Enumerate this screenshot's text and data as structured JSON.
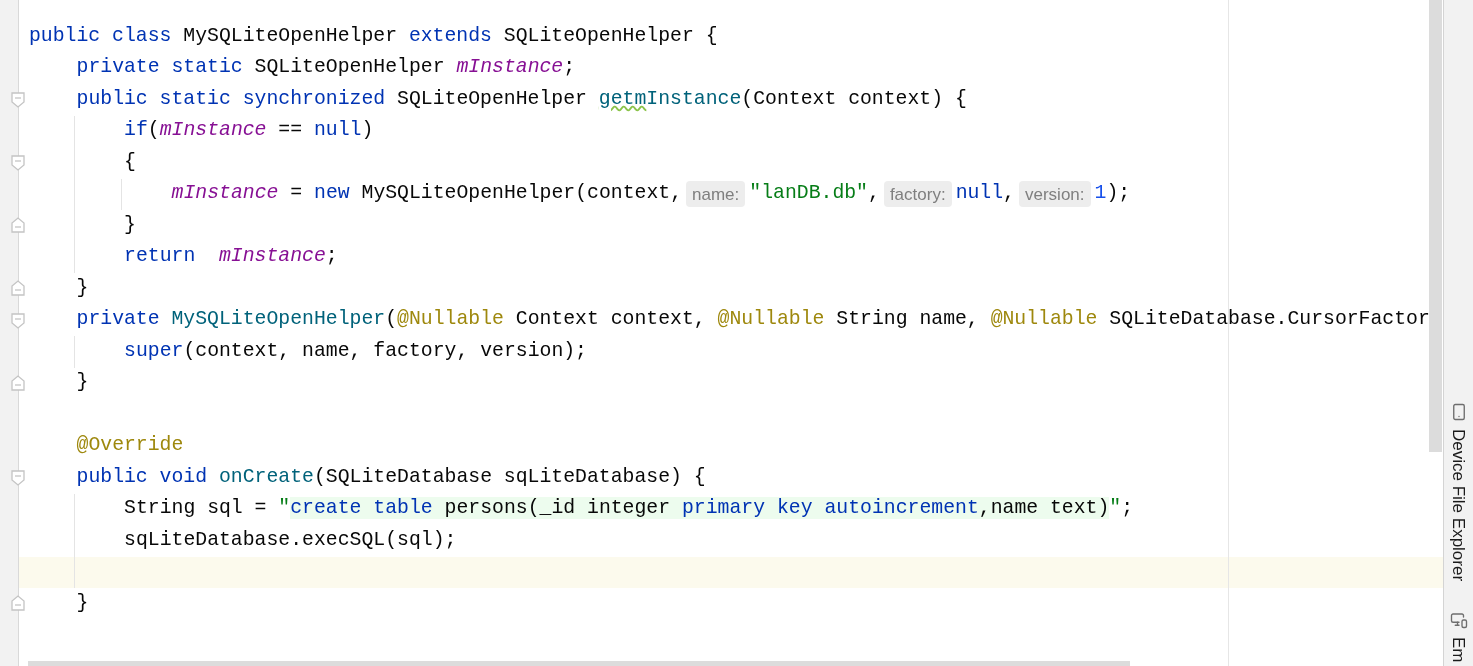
{
  "editor": {
    "lines": [
      {
        "current": false,
        "fold_start": false,
        "fold_end": false,
        "segments": [
          {
            "kind": "code",
            "tokens": [
              {
                "kind": "keyword",
                "text": "public class"
              },
              {
                "kind": "plain",
                "text": " MySQLiteOpenHelper "
              },
              {
                "kind": "keyword",
                "text": "extends"
              },
              {
                "kind": "plain",
                "text": " SQLiteOpenHelper {"
              }
            ]
          }
        ],
        "children": [
          {
            "current": false,
            "fold_start": false,
            "fold_end": false,
            "segments": [
              {
                "kind": "code",
                "tokens": [
                  {
                    "kind": "keyword",
                    "text": "private static"
                  },
                  {
                    "kind": "plain",
                    "text": " SQLiteOpenHelper "
                  },
                  {
                    "kind": "field",
                    "text": "mInstance"
                  },
                  {
                    "kind": "plain",
                    "text": ";"
                  }
                ]
              }
            ]
          },
          {
            "current": false,
            "fold_start": true,
            "fold_end": false,
            "segments": [
              {
                "kind": "code",
                "tokens": [
                  {
                    "kind": "keyword",
                    "text": "public static synchronized"
                  },
                  {
                    "kind": "plain",
                    "text": " SQLiteOpenHelper "
                  },
                  {
                    "kind": "method_warning",
                    "text": "getm"
                  },
                  {
                    "kind": "method",
                    "text": "Instance"
                  },
                  {
                    "kind": "plain",
                    "text": "(Context context) {"
                  }
                ]
              }
            ],
            "children": [
              {
                "current": false,
                "fold_start": false,
                "fold_end": false,
                "segments": [
                  {
                    "kind": "code",
                    "tokens": [
                      {
                        "kind": "keyword",
                        "text": "if"
                      },
                      {
                        "kind": "plain",
                        "text": "("
                      },
                      {
                        "kind": "field",
                        "text": "mInstance"
                      },
                      {
                        "kind": "plain",
                        "text": " == "
                      },
                      {
                        "kind": "keyword",
                        "text": "null"
                      },
                      {
                        "kind": "plain",
                        "text": ")"
                      }
                    ]
                  }
                ]
              },
              {
                "current": false,
                "fold_start": true,
                "fold_end": false,
                "segments": [
                  {
                    "kind": "code",
                    "tokens": [
                      {
                        "kind": "plain",
                        "text": "{"
                      }
                    ]
                  }
                ],
                "children": [
                  {
                    "current": false,
                    "fold_start": false,
                    "fold_end": false,
                    "segments": [
                      {
                        "kind": "code",
                        "tokens": [
                          {
                            "kind": "field",
                            "text": "mInstance"
                          },
                          {
                            "kind": "plain",
                            "text": " = "
                          },
                          {
                            "kind": "keyword",
                            "text": "new"
                          },
                          {
                            "kind": "plain",
                            "text": " MySQLiteOpenHelper(context,"
                          }
                        ]
                      },
                      {
                        "kind": "hint",
                        "text": "name:"
                      },
                      {
                        "kind": "code",
                        "tokens": [
                          {
                            "kind": "string",
                            "text": "\"lanDB.db\""
                          },
                          {
                            "kind": "plain",
                            "text": ","
                          }
                        ]
                      },
                      {
                        "kind": "hint",
                        "text": "factory:"
                      },
                      {
                        "kind": "code",
                        "tokens": [
                          {
                            "kind": "keyword",
                            "text": "null"
                          },
                          {
                            "kind": "plain",
                            "text": ","
                          }
                        ]
                      },
                      {
                        "kind": "hint",
                        "text": "version:"
                      },
                      {
                        "kind": "code",
                        "tokens": [
                          {
                            "kind": "number",
                            "text": "1"
                          },
                          {
                            "kind": "plain",
                            "text": ");"
                          }
                        ]
                      }
                    ]
                  }
                ]
              },
              {
                "current": false,
                "fold_start": false,
                "fold_end": true,
                "segments": [
                  {
                    "kind": "code",
                    "tokens": [
                      {
                        "kind": "plain",
                        "text": "}"
                      }
                    ]
                  }
                ]
              },
              {
                "current": false,
                "fold_start": false,
                "fold_end": false,
                "segments": [
                  {
                    "kind": "code",
                    "tokens": [
                      {
                        "kind": "keyword",
                        "text": "return  "
                      },
                      {
                        "kind": "field",
                        "text": "mInstance"
                      },
                      {
                        "kind": "plain",
                        "text": ";"
                      }
                    ]
                  }
                ]
              }
            ]
          },
          {
            "current": false,
            "fold_start": false,
            "fold_end": true,
            "segments": [
              {
                "kind": "code",
                "tokens": [
                  {
                    "kind": "plain",
                    "text": "}"
                  }
                ]
              }
            ]
          },
          {
            "current": false,
            "fold_start": true,
            "fold_end": false,
            "segments": [
              {
                "kind": "code",
                "tokens": [
                  {
                    "kind": "keyword",
                    "text": "private "
                  },
                  {
                    "kind": "method",
                    "text": "MySQLiteOpenHelper"
                  },
                  {
                    "kind": "plain",
                    "text": "("
                  },
                  {
                    "kind": "annotation",
                    "text": "@Nullable"
                  },
                  {
                    "kind": "plain",
                    "text": " Context context, "
                  },
                  {
                    "kind": "annotation",
                    "text": "@Nullable"
                  },
                  {
                    "kind": "plain",
                    "text": " String name, "
                  },
                  {
                    "kind": "annotation",
                    "text": "@Nullable"
                  },
                  {
                    "kind": "plain",
                    "text": " SQLiteDatabase.CursorFactor"
                  }
                ]
              }
            ],
            "children": [
              {
                "current": false,
                "fold_start": false,
                "fold_end": false,
                "segments": [
                  {
                    "kind": "code",
                    "tokens": [
                      {
                        "kind": "keyword",
                        "text": "super"
                      },
                      {
                        "kind": "plain",
                        "text": "(context, name, factory, version);"
                      }
                    ]
                  }
                ]
              }
            ]
          },
          {
            "current": false,
            "fold_start": false,
            "fold_end": true,
            "segments": [
              {
                "kind": "code",
                "tokens": [
                  {
                    "kind": "plain",
                    "text": "}"
                  }
                ]
              }
            ]
          },
          {
            "current": false,
            "fold_start": false,
            "fold_end": false
          },
          {
            "current": false,
            "fold_start": false,
            "fold_end": false,
            "segments": [
              {
                "kind": "code",
                "tokens": [
                  {
                    "kind": "annotation",
                    "text": "@Override"
                  }
                ]
              }
            ]
          },
          {
            "current": false,
            "fold_start": true,
            "fold_end": false,
            "segments": [
              {
                "kind": "code",
                "tokens": [
                  {
                    "kind": "keyword",
                    "text": "public void "
                  },
                  {
                    "kind": "method",
                    "text": "onCreate"
                  },
                  {
                    "kind": "plain",
                    "text": "(SQLiteDatabase sqLiteDatabase) {"
                  }
                ]
              }
            ],
            "children": [
              {
                "current": false,
                "fold_start": false,
                "fold_end": false,
                "segments": [
                  {
                    "kind": "code",
                    "tokens": [
                      {
                        "kind": "plain",
                        "text": "String sql = "
                      },
                      {
                        "kind": "string",
                        "text": "\""
                      },
                      {
                        "kind": "sql_keyword",
                        "text": "create table"
                      },
                      {
                        "kind": "sql_text",
                        "text": " persons(_id integer "
                      },
                      {
                        "kind": "sql_keyword",
                        "text": "primary key autoincrement"
                      },
                      {
                        "kind": "sql_text",
                        "text": ",name text)"
                      },
                      {
                        "kind": "string",
                        "text": "\""
                      },
                      {
                        "kind": "plain",
                        "text": ";"
                      }
                    ]
                  }
                ]
              },
              {
                "current": false,
                "fold_start": false,
                "fold_end": false,
                "segments": [
                  {
                    "kind": "code",
                    "tokens": [
                      {
                        "kind": "plain",
                        "text": "sqLiteDatabase.execSQL(sql);"
                      }
                    ]
                  }
                ]
              },
              {
                "current": true,
                "fold_start": false,
                "fold_end": false
              }
            ]
          },
          {
            "current": false,
            "fold_start": false,
            "fold_end": true,
            "segments": [
              {
                "kind": "code",
                "tokens": [
                  {
                    "kind": "plain",
                    "text": "}"
                  }
                ]
              }
            ]
          },
          {
            "current": false,
            "fold_start": false,
            "fold_end": false
          }
        ]
      }
    ]
  },
  "tool_strip": [
    {
      "kind": "device",
      "label": "Device File Explorer"
    },
    {
      "kind": "emulator",
      "label": "Em"
    }
  ]
}
